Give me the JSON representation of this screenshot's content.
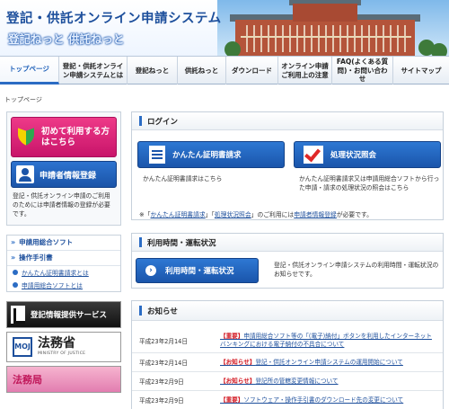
{
  "header": {
    "title": "登記・供託オンライン申請システム",
    "subtitle": "登記ねっと 供託ねっと"
  },
  "nav": {
    "items": [
      {
        "label": "トップページ",
        "active": true
      },
      {
        "label": "登記・供託オンライン申請システムとは",
        "active": false
      },
      {
        "label": "登記ねっと",
        "active": false
      },
      {
        "label": "供託ねっと",
        "active": false
      },
      {
        "label": "ダウンロード",
        "active": false
      },
      {
        "label": "オンライン申請ご利用上の注意",
        "active": false
      },
      {
        "label": "FAQ(よくある質問)・お問い合わせ",
        "active": false
      },
      {
        "label": "サイトマップ",
        "active": false
      }
    ]
  },
  "breadcrumb": "トップページ",
  "left": {
    "first_time_button": "初めて利用する方はこちら",
    "register_button": "申請者情報登録",
    "register_note": "登記・供託オンライン申請のご利用のためには申請者情報の登録が必要です。",
    "software_heading": "申請用総合ソフト",
    "manual_heading": "操作手引書",
    "manual_links": [
      "かんたん証明書請求とは",
      "申請用総合ソフトとは"
    ],
    "banner_data": "登記情報提供サービス",
    "banner_moj": "法務省",
    "banner_moj_en": "MINISTRY OF JUSTICE",
    "banner_kid": "法務局"
  },
  "login": {
    "heading": "ログイン",
    "cert_button": "かんたん証明書請求",
    "cert_desc": "かんたん証明書請求はこちら",
    "status_button": "処理状況照会",
    "status_desc": "かんたん証明書請求又は申請用総合ソフトから行った申請・請求の処理状況の照会はこちら",
    "note_prefix": "※「",
    "note_link1": "かんたん証明書請求",
    "note_mid1": "」「",
    "note_link2": "処理状況照会",
    "note_mid2": "」のご利用には",
    "note_link3": "申請者情報登録",
    "note_suffix": "が必要です。"
  },
  "hours": {
    "heading": "利用時間・運転状況",
    "button": "利用時間・運転状況",
    "desc": "登記・供託オンライン申請システムの利用時間・運転状況のお知らせです。"
  },
  "news": {
    "heading": "お知らせ",
    "items": [
      {
        "date": "平成23年2月14日",
        "tag": "【重要】",
        "text": "申請用総合ソフト等の「(電子)納付」ボタンを利用したインターネットバンキングにおける電子納付の不具合について"
      },
      {
        "date": "平成23年2月14日",
        "tag": "【お知らせ】",
        "text": "登記・供託オンライン申請システムの運用開始について"
      },
      {
        "date": "平成23年2月9日",
        "tag": "【お知らせ】",
        "text": "登記所の管轄変更情報について"
      },
      {
        "date": "平成23年2月9日",
        "tag": "【重要】",
        "text": "ソフトウェア・操作手引書のダウンロード先の変更について"
      }
    ]
  }
}
